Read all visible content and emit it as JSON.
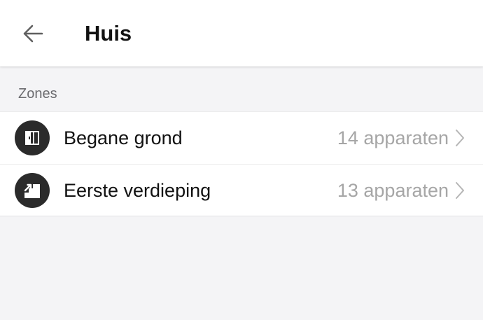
{
  "header": {
    "title": "Huis",
    "back_icon": "arrow-left-icon"
  },
  "section": {
    "label": "Zones"
  },
  "zones": [
    {
      "name": "Begane grond",
      "count": "14 apparaten",
      "icon": "door-icon"
    },
    {
      "name": "Eerste verdieping",
      "count": "13 apparaten",
      "icon": "stairs-icon"
    }
  ],
  "colors": {
    "background": "#f4f4f6",
    "surface": "#ffffff",
    "icon_circle": "#2b2b2b",
    "muted_text": "#a6a6a6",
    "section_text": "#6b6b6f"
  }
}
